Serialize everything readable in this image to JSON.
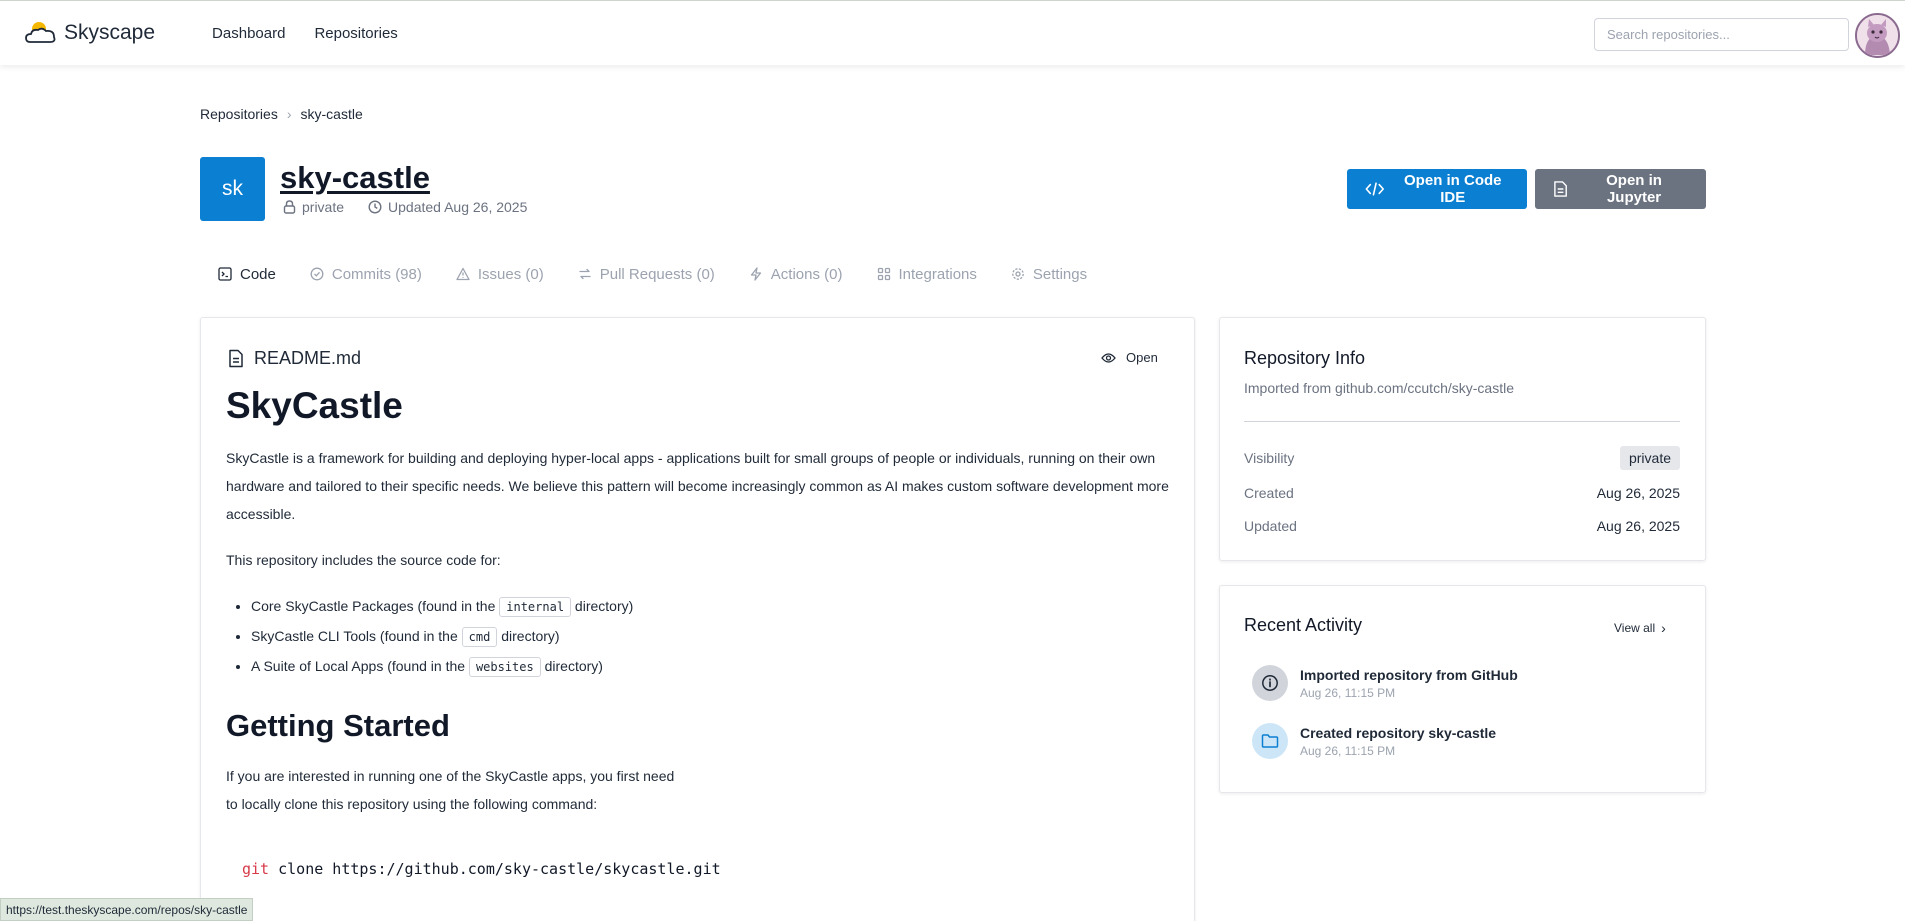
{
  "app": {
    "brand": "Skyscape"
  },
  "nav": {
    "items": [
      "Dashboard",
      "Repositories"
    ]
  },
  "search": {
    "placeholder": "Search repositories..."
  },
  "breadcrumb": {
    "items": [
      "Repositories",
      "sky-castle"
    ]
  },
  "repo": {
    "badge": "sk",
    "name": "sky-castle",
    "visibility": "private",
    "updated": "Updated Aug 26, 2025"
  },
  "actions": {
    "open_ide": "Open in Code IDE",
    "open_jupyter": "Open in Jupyter"
  },
  "tabs": [
    {
      "label": "Code",
      "icon": "terminal-icon"
    },
    {
      "label": "Commits (98)",
      "icon": "commit-icon"
    },
    {
      "label": "Issues (0)",
      "icon": "warning-icon"
    },
    {
      "label": "Pull Requests (0)",
      "icon": "pull-request-icon"
    },
    {
      "label": "Actions (0)",
      "icon": "bolt-icon"
    },
    {
      "label": "Integrations",
      "icon": "grid-icon"
    },
    {
      "label": "Settings",
      "icon": "gear-icon"
    }
  ],
  "readme": {
    "filename": "README.md",
    "open_label": "Open",
    "h1": "SkyCastle",
    "p1": "SkyCastle is a framework for building and deploying hyper-local apps - applications built for small groups of people or individuals, running on their own hardware and tailored to their specific needs. We believe this pattern will become increasingly common as AI makes custom software development more accessible.",
    "p2": "This repository includes the source code for:",
    "list": [
      {
        "pre": "Core SkyCastle Packages (found in the ",
        "code": "internal",
        "post": " directory)"
      },
      {
        "pre": "SkyCastle CLI Tools (found in the ",
        "code": "cmd",
        "post": " directory)"
      },
      {
        "pre": "A Suite of Local Apps (found in the ",
        "code": "websites",
        "post": " directory)"
      }
    ],
    "h2": "Getting Started",
    "p3_line1": "If you are interested in running one of the SkyCastle apps, you first need",
    "p3_line2": "to locally clone this repository using the following command:",
    "code_kw": "git",
    "code_rest": " clone https://github.com/sky-castle/skycastle.git"
  },
  "info": {
    "title": "Repository Info",
    "subtitle": "Imported from github.com/ccutch/sky-castle",
    "rows": [
      {
        "label": "Visibility",
        "value": "private"
      },
      {
        "label": "Created",
        "value": "Aug 26, 2025"
      },
      {
        "label": "Updated",
        "value": "Aug 26, 2025"
      }
    ]
  },
  "activity": {
    "title": "Recent Activity",
    "view_all": "View all",
    "items": [
      {
        "title": "Imported repository from GitHub",
        "time": "Aug 26, 11:15 PM",
        "icon": "info-icon"
      },
      {
        "title": "Created repository sky-castle",
        "time": "Aug 26, 11:15 PM",
        "icon": "folder-icon"
      }
    ]
  },
  "status_url": "https://test.theskyscape.com/repos/sky-castle",
  "colors": {
    "primary": "#0b7fd1",
    "secondary": "#6b7280"
  }
}
